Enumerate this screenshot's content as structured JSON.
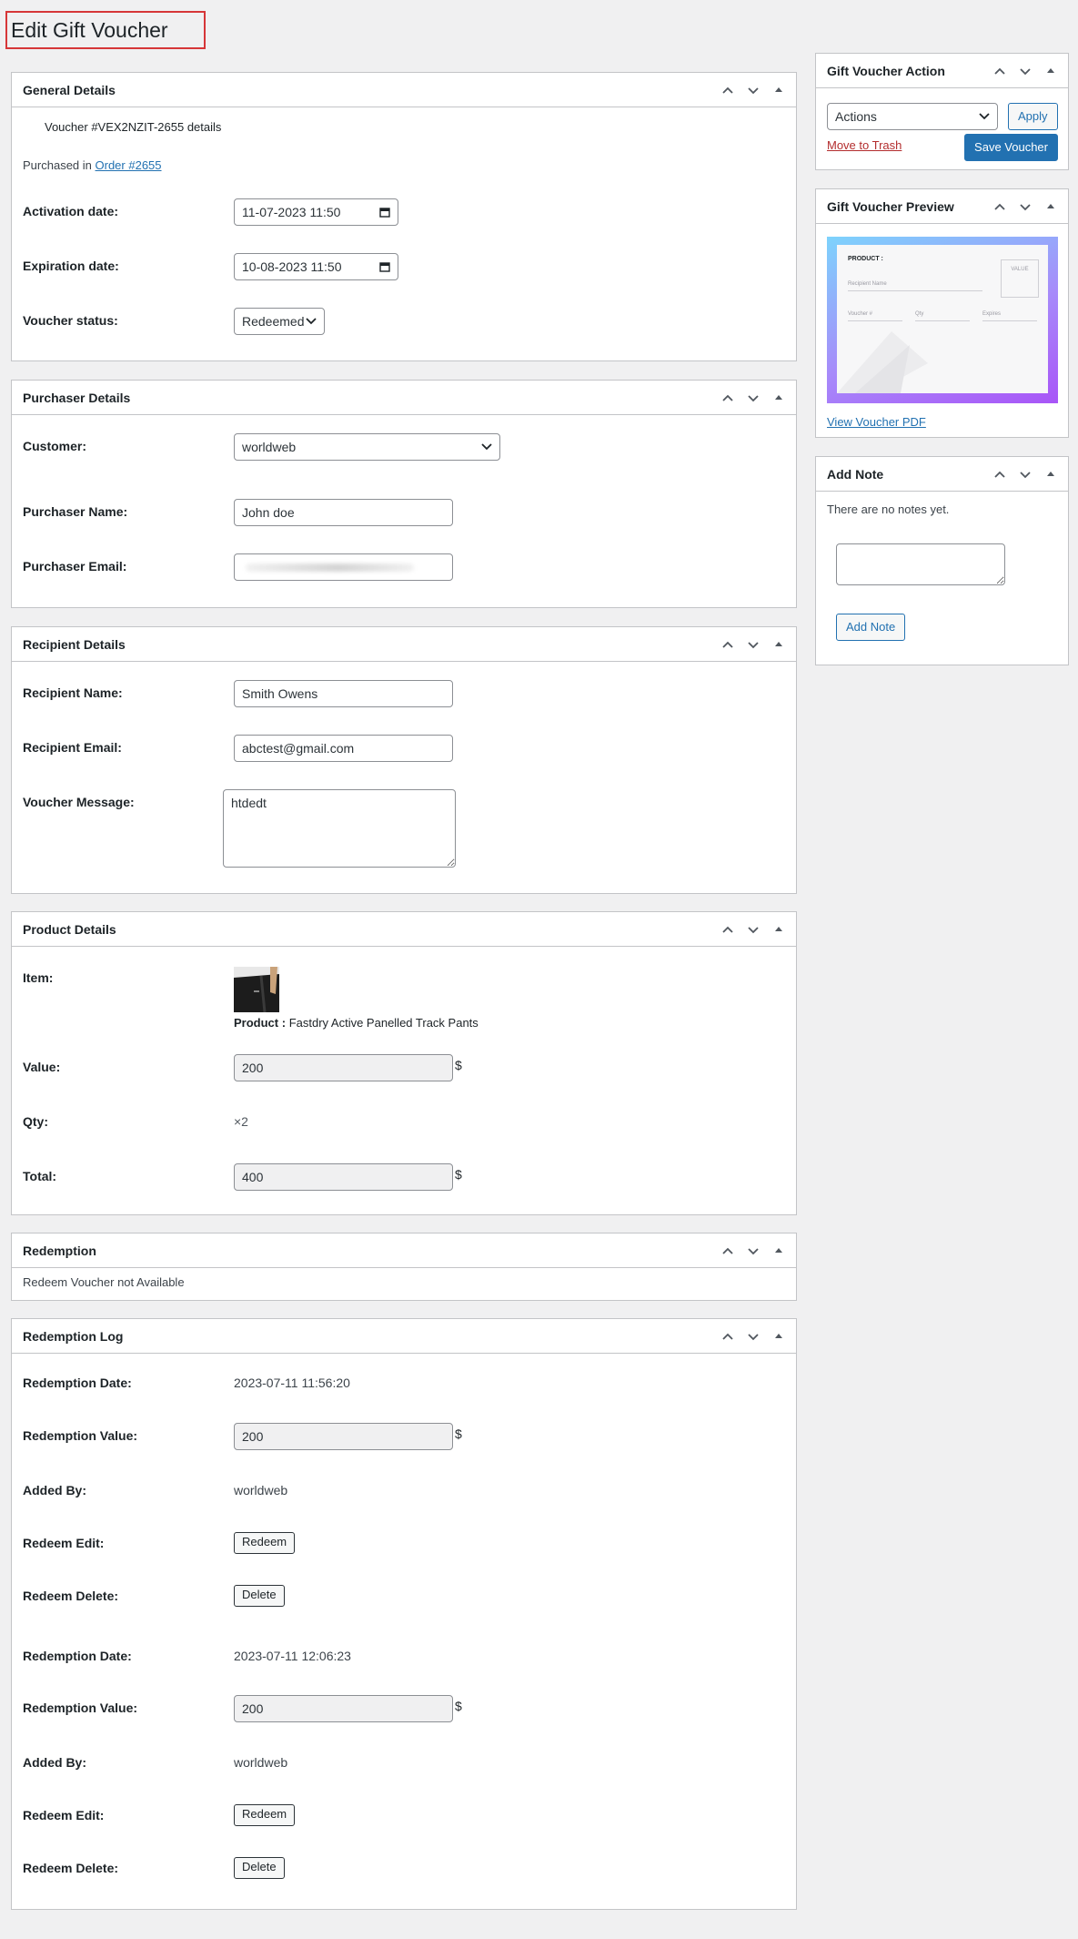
{
  "page": {
    "title": "Edit Gift Voucher"
  },
  "general": {
    "title": "General Details",
    "voucher_line": "Voucher #VEX2NZIT-2655 details",
    "purchased_prefix": "Purchased in",
    "order_link": "Order #2655",
    "activation_label": "Activation date:",
    "activation_value": "11-07-2023 11:50",
    "expiration_label": "Expiration date:",
    "expiration_value": "10-08-2023 11:50",
    "status_label": "Voucher status:",
    "status_value": "Redeemed"
  },
  "purchaser": {
    "title": "Purchaser Details",
    "customer_label": "Customer:",
    "customer_value": "worldweb",
    "name_label": "Purchaser Name:",
    "name_value": "John doe",
    "email_label": "Purchaser Email:",
    "email_value": ""
  },
  "recipient": {
    "title": "Recipient Details",
    "name_label": "Recipient Name:",
    "name_value": "Smith Owens",
    "email_label": "Recipient Email:",
    "email_value": "abctest@gmail.com",
    "message_label": "Voucher Message:",
    "message_value": "htdedt"
  },
  "product": {
    "title": "Product Details",
    "item_label": "Item:",
    "product_prefix": "Product :",
    "product_name": "Fastdry Active Panelled Track Pants",
    "value_label": "Value:",
    "value": "200",
    "currency": "$",
    "qty_label": "Qty:",
    "qty_value": "×2",
    "total_label": "Total:",
    "total_value": "400"
  },
  "redemption": {
    "title": "Redemption",
    "message": "Redeem Voucher not Available"
  },
  "redemption_log": {
    "title": "Redemption Log",
    "date_label": "Redemption Date:",
    "value_label": "Redemption Value:",
    "added_by_label": "Added By:",
    "edit_label": "Redeem Edit:",
    "delete_label": "Redeem Delete:",
    "entries": [
      {
        "date": "2023-07-11 11:56:20",
        "value": "200",
        "added_by": "worldweb",
        "edit_button": "Redeem",
        "delete_button": "Delete"
      },
      {
        "date": "2023-07-11 12:06:23",
        "value": "200",
        "added_by": "worldweb",
        "edit_button": "Redeem",
        "delete_button": "Delete"
      }
    ]
  },
  "action_box": {
    "title": "Gift Voucher Action",
    "actions_select": "Actions",
    "apply_button": "Apply",
    "trash_link": "Move to Trash",
    "save_button": "Save Voucher"
  },
  "preview_box": {
    "title": "Gift Voucher Preview",
    "card_product": "PRODUCT :",
    "card_value": "VALUE",
    "card_recipient": "Recipient Name",
    "card_voucher": "Voucher #",
    "card_qty": "Qty",
    "card_expires": "Expires",
    "pdf_link": "View Voucher PDF"
  },
  "note_box": {
    "title": "Add Note",
    "empty_text": "There are no notes yet.",
    "add_button": "Add Note"
  },
  "colors": {
    "accent": "#2271b1",
    "danger": "#b32d2e",
    "highlight_border": "#d63638",
    "card_gradient_top": "#7dd3fc",
    "card_gradient_bottom": "#a855f7"
  }
}
